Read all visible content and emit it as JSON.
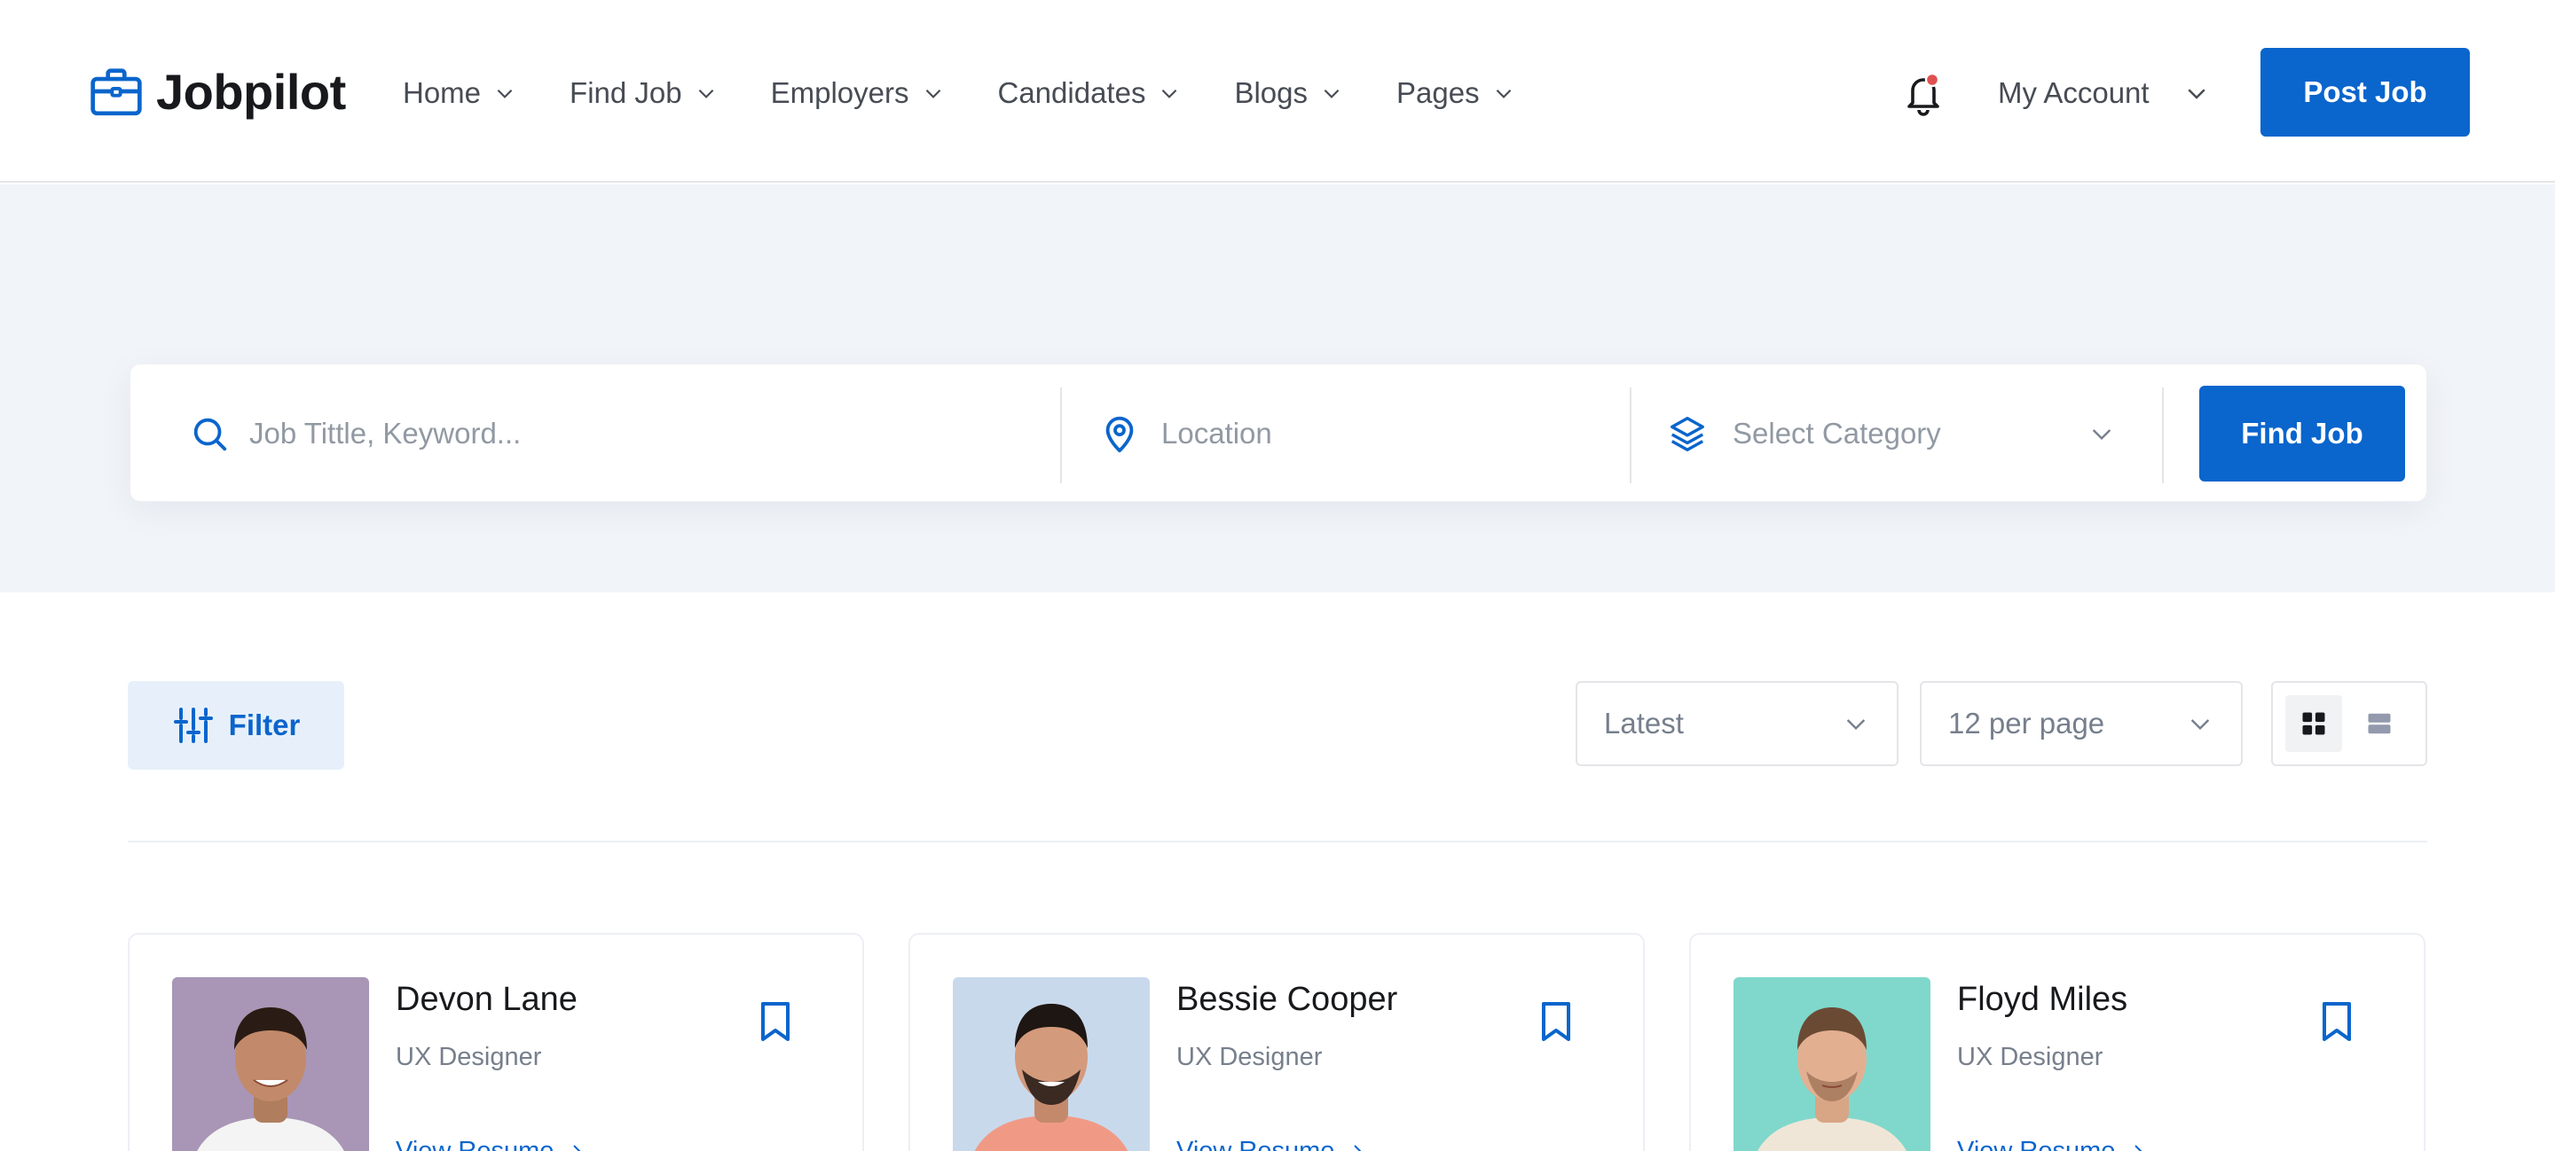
{
  "brand": {
    "name": "Jobpilot",
    "icon": "briefcase-icon",
    "accent": "#0a65cc"
  },
  "nav": {
    "items": [
      {
        "label": "Home"
      },
      {
        "label": "Find Job"
      },
      {
        "label": "Employers"
      },
      {
        "label": "Candidates"
      },
      {
        "label": "Blogs"
      },
      {
        "label": "Pages"
      }
    ]
  },
  "header": {
    "notification_icon": "bell-icon",
    "account_label": "My Account",
    "post_job_label": "Post Job"
  },
  "search": {
    "keyword_placeholder": "Job Tittle, Keyword...",
    "location_placeholder": "Location",
    "category_label": "Select Category",
    "submit_label": "Find Job"
  },
  "toolbar": {
    "filter_label": "Filter",
    "sort_value": "Latest",
    "per_page_value": "12 per page",
    "active_view": "grid"
  },
  "candidates": [
    {
      "name": "Devon Lane",
      "role": "UX Designer",
      "link": "View Resume"
    },
    {
      "name": "Bessie Cooper",
      "role": "UX Designer",
      "link": "View Resume"
    },
    {
      "name": "Floyd Miles",
      "role": "UX Designer",
      "link": "View Resume"
    }
  ]
}
